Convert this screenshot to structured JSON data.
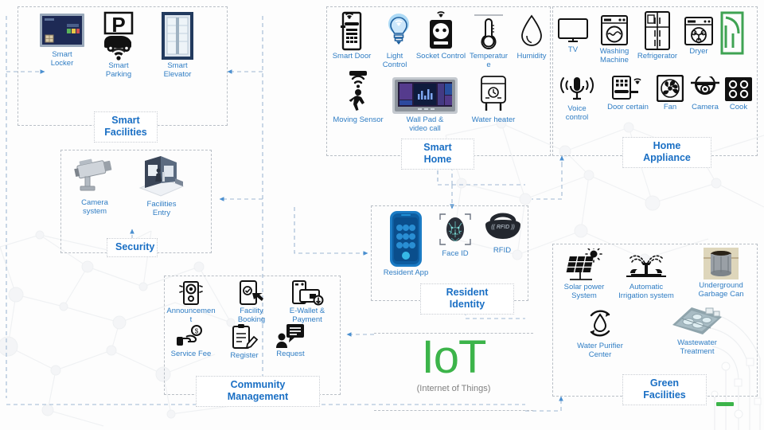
{
  "diagram": {
    "center": {
      "word": "IoT",
      "subtitle": "(Internet of Things)",
      "accent_color": "#3cb44a"
    },
    "label_color": "#2f7dc4",
    "title_color": "#1a6fc4",
    "box_border_color": "#b9bfc6"
  },
  "groups": [
    {
      "id": "smart-facilities",
      "title": "Smart\nFacilities",
      "items": [
        {
          "label": "Smart\nLocker",
          "icon": "smart-locker-icon"
        },
        {
          "label": "Smart\nParking",
          "icon": "smart-parking-icon"
        },
        {
          "label": "Smart\nElevator",
          "icon": "smart-elevator-icon"
        }
      ]
    },
    {
      "id": "smart-home",
      "title": "Smart Home",
      "items": [
        {
          "label": "Smart Door",
          "icon": "smart-door-lock-icon"
        },
        {
          "label": "Light\nControl",
          "icon": "light-bulb-icon"
        },
        {
          "label": "Socket Control",
          "icon": "smart-socket-icon"
        },
        {
          "label": "Temperatur\ne",
          "icon": "thermometer-icon"
        },
        {
          "label": "Humidity",
          "icon": "water-drop-icon"
        },
        {
          "label": "Moving Sensor",
          "icon": "motion-sensor-icon"
        },
        {
          "label": "Wall Pad &\nvideo call",
          "icon": "wall-pad-icon"
        },
        {
          "label": "Water heater",
          "icon": "water-heater-icon"
        }
      ]
    },
    {
      "id": "home-appliance",
      "title": "Home Appliance",
      "items": [
        {
          "label": "TV",
          "icon": "tv-icon"
        },
        {
          "label": "Washing\nMachine",
          "icon": "washing-machine-icon"
        },
        {
          "label": "Refrigerator",
          "icon": "refrigerator-icon"
        },
        {
          "label": "Dryer",
          "icon": "dryer-icon"
        },
        {
          "label": "Voice\ncontrol",
          "icon": "voice-control-icon"
        },
        {
          "label": "Door certain",
          "icon": "door-keypad-icon"
        },
        {
          "label": "Fan",
          "icon": "fan-icon"
        },
        {
          "label": "Camera",
          "icon": "dome-camera-icon"
        },
        {
          "label": "Cook",
          "icon": "cooktop-icon"
        }
      ]
    },
    {
      "id": "security",
      "title": "Security",
      "items": [
        {
          "label": "Camera\nsystem",
          "icon": "cctv-camera-icon"
        },
        {
          "label": "Facilities\nEntry",
          "icon": "facilities-entry-icon"
        }
      ]
    },
    {
      "id": "community-management",
      "title": "Community Management",
      "items": [
        {
          "label": "Announcemen\nt",
          "icon": "announcement-icon"
        },
        {
          "label": "Facility\nBooking",
          "icon": "facility-booking-icon"
        },
        {
          "label": "E-Wallet &\nPayment",
          "icon": "e-wallet-icon"
        },
        {
          "label": "Service Fee",
          "icon": "service-fee-icon"
        },
        {
          "label": "Register",
          "icon": "register-clipboard-icon"
        },
        {
          "label": "Request",
          "icon": "request-chat-icon"
        }
      ]
    },
    {
      "id": "resident-identity",
      "title": "Resident Identity",
      "items": [
        {
          "label": "Resident App",
          "icon": "resident-app-icon"
        },
        {
          "label": "Face ID",
          "icon": "face-id-icon"
        },
        {
          "label": "RFID",
          "icon": "rfid-tag-icon"
        }
      ]
    },
    {
      "id": "green-facilities",
      "title": "Green Facilities",
      "items": [
        {
          "label": "Solar power\nSystem",
          "icon": "solar-panel-icon"
        },
        {
          "label": "Automatic\nIrrigation system",
          "icon": "irrigation-icon"
        },
        {
          "label": "Underground\nGarbage Can",
          "icon": "underground-garbage-icon"
        },
        {
          "label": "Water Purifier\nCenter",
          "icon": "water-purifier-icon"
        },
        {
          "label": "Wastewater\nTreatment",
          "icon": "wastewater-treatment-icon"
        }
      ]
    }
  ]
}
